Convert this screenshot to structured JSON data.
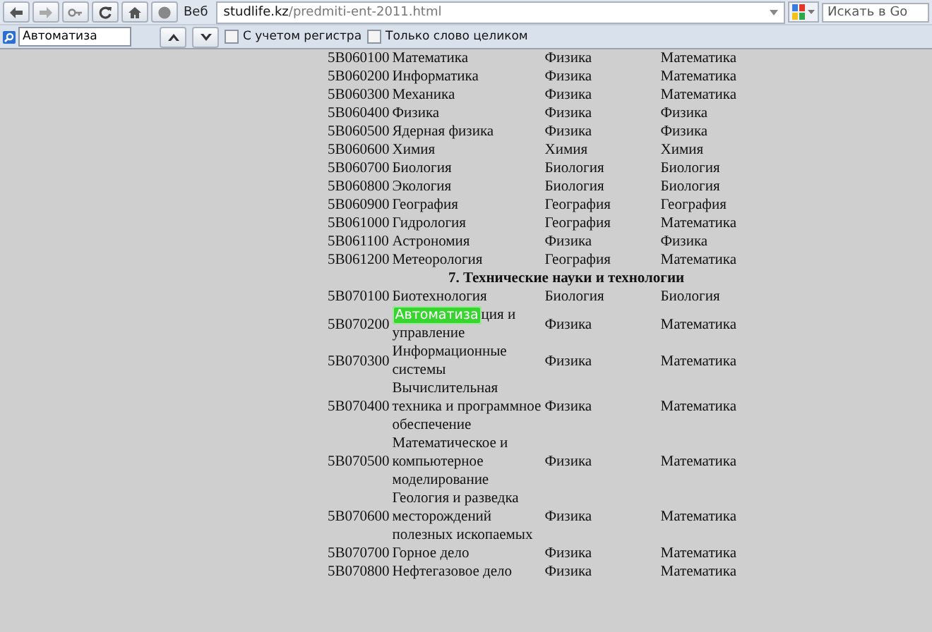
{
  "toolbar": {
    "web_label": "Веб",
    "url": {
      "host": "studlife.kz",
      "path": "/predmiti-ent-2011.html"
    },
    "search": {
      "placeholder": "Искать в Go"
    }
  },
  "find_bar": {
    "query": "Автоматиза",
    "options": [
      {
        "label": "С учетом регистра",
        "checked": false
      },
      {
        "label": "Только слово целиком",
        "checked": false
      }
    ]
  },
  "table": {
    "rows": [
      {
        "kind": "row",
        "code": "5B060100",
        "name": "Математика",
        "subject_1": "Физика",
        "subject_2": "Математика"
      },
      {
        "kind": "row",
        "code": "5B060200",
        "name": "Информатика",
        "subject_1": "Физика",
        "subject_2": "Математика"
      },
      {
        "kind": "row",
        "code": "5B060300",
        "name": "Механика",
        "subject_1": "Физика",
        "subject_2": "Математика"
      },
      {
        "kind": "row",
        "code": "5B060400",
        "name": "Физика",
        "subject_1": "Физика",
        "subject_2": "Физика"
      },
      {
        "kind": "row",
        "code": "5B060500",
        "name": "Ядерная физика",
        "subject_1": "Физика",
        "subject_2": "Физика"
      },
      {
        "kind": "row",
        "code": "5B060600",
        "name": "Химия",
        "subject_1": "Химия",
        "subject_2": "Химия"
      },
      {
        "kind": "row",
        "code": "5B060700",
        "name": "Биология",
        "subject_1": "Биология",
        "subject_2": "Биология"
      },
      {
        "kind": "row",
        "code": "5B060800",
        "name": "Экология",
        "subject_1": "Биология",
        "subject_2": "Биология"
      },
      {
        "kind": "row",
        "code": "5B060900",
        "name": "География",
        "subject_1": "География",
        "subject_2": "География"
      },
      {
        "kind": "row",
        "code": "5B061000",
        "name": "Гидрология",
        "subject_1": "География",
        "subject_2": "Математика"
      },
      {
        "kind": "row",
        "code": "5B061100",
        "name": "Астрономия",
        "subject_1": "Физика",
        "subject_2": "Физика"
      },
      {
        "kind": "row",
        "code": "5B061200",
        "name": "Метеорология",
        "subject_1": "География",
        "subject_2": "Математика"
      },
      {
        "kind": "section",
        "title": "7. Технические науки и технологии"
      },
      {
        "kind": "row",
        "code": "5B070100",
        "name": "Биотехнология",
        "subject_1": "Биология",
        "subject_2": "Биология"
      },
      {
        "kind": "row",
        "code": "5B070200",
        "find_match": "Автоматиза",
        "name": "ция и управление",
        "subject_1": "Физика",
        "subject_2": "Математика"
      },
      {
        "kind": "row",
        "code": "5B070300",
        "name": "Информационные системы",
        "subject_1": "Физика",
        "subject_2": "Математика"
      },
      {
        "kind": "row",
        "code": "5B070400",
        "name": "Вычислительная техника и программное обеспечение",
        "subject_1": "Физика",
        "subject_2": "Математика"
      },
      {
        "kind": "row",
        "code": "5B070500",
        "name": "Математическое и компьютерное моделирование",
        "subject_1": "Физика",
        "subject_2": "Математика"
      },
      {
        "kind": "row",
        "code": "5B070600",
        "name": "Геология и разведка месторождений полезных ископаемых",
        "subject_1": "Физика",
        "subject_2": "Математика"
      },
      {
        "kind": "row",
        "code": "5B070700",
        "name": "Горное дело",
        "subject_1": "Физика",
        "subject_2": "Математика"
      },
      {
        "kind": "row",
        "code": "5B070800",
        "name": "Нефтегазовое дело",
        "subject_1": "Физика",
        "subject_2": "Математика"
      }
    ]
  }
}
